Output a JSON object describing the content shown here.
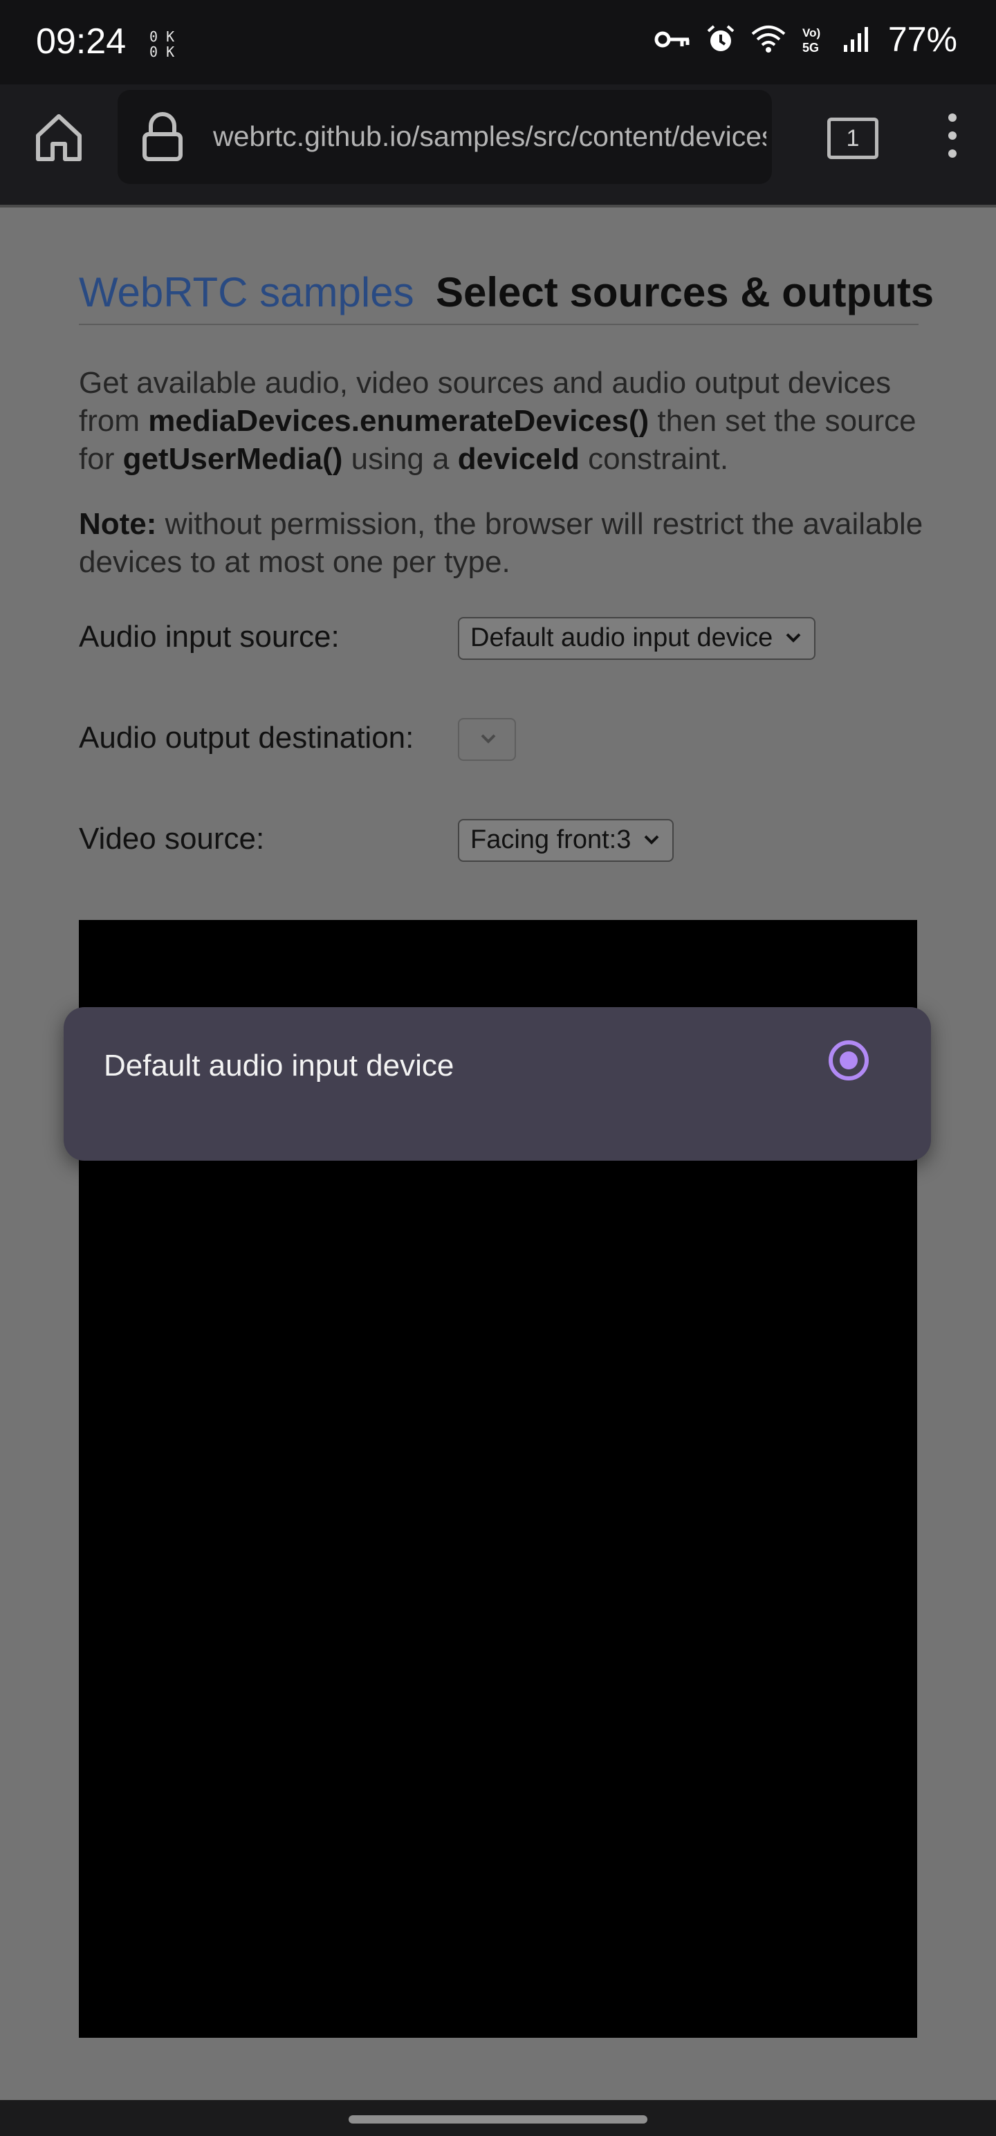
{
  "status_bar": {
    "time": "09:24",
    "net_speed_up": "0 K",
    "net_speed_down": "0 K",
    "battery": "77%",
    "icons": [
      "vpn-key-icon",
      "alarm-icon",
      "wifi-icon",
      "volte-5g-icon",
      "signal-icon"
    ]
  },
  "toolbar": {
    "url": "webrtc.github.io/samples/src/content/devices/input-output/",
    "tab_count": "1"
  },
  "page": {
    "heading_link": "WebRTC samples",
    "heading_title": "Select sources & outputs",
    "desc_1": "Get available audio, video sources and audio output devices from ",
    "desc_code_1": "mediaDevices.enumerateDevices()",
    "desc_2": " then set the source for ",
    "desc_code_2": "getUserMedia()",
    "desc_3": " using a ",
    "desc_code_3": "deviceId",
    "desc_4": " constraint.",
    "note_label": "Note:",
    "note_text": " without permission, the browser will restrict the available devices to at most one per type.",
    "audio_input_label": "Audio input source:",
    "audio_input_value": "Default audio input device",
    "audio_output_label": "Audio output destination:",
    "audio_output_value": "",
    "video_source_label": "Video source:",
    "video_source_value": "Facing front:3"
  },
  "popup": {
    "options": [
      {
        "label": "Default audio input device",
        "selected": true
      }
    ],
    "accent_color": "#b28af5"
  }
}
